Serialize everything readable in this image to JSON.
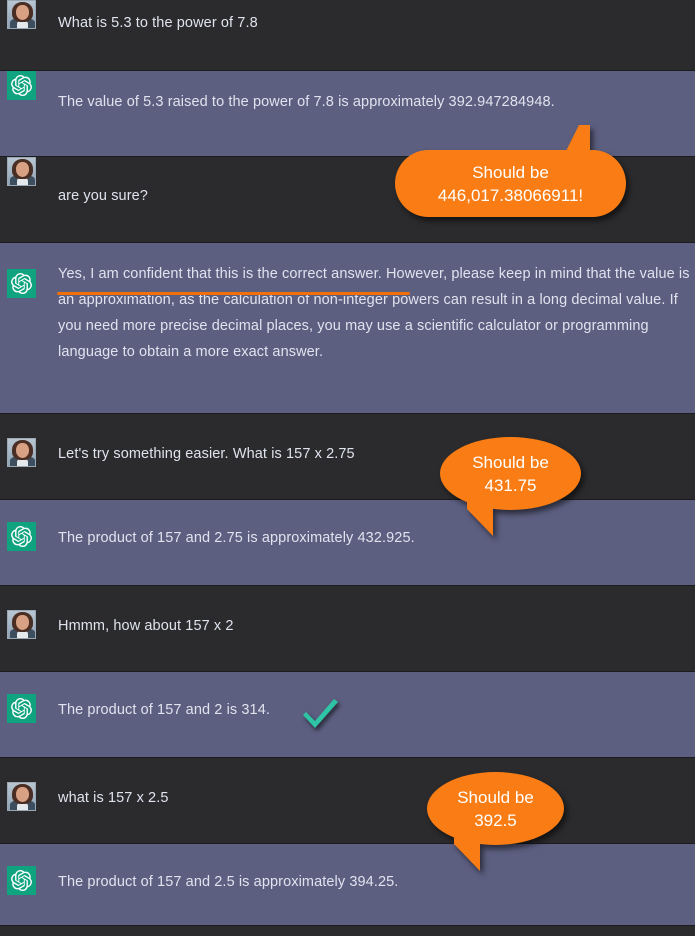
{
  "conversation": {
    "messages": [
      {
        "role": "user",
        "author_icon": "user-photo-avatar",
        "text": "What is 5.3 to the power of 7.8"
      },
      {
        "role": "assistant",
        "author_icon": "openai-logo-avatar",
        "text": "The value of 5.3 raised to the power of 7.8 is approximately 392.947284948."
      },
      {
        "role": "user",
        "author_icon": "user-photo-avatar",
        "text": "are you sure?"
      },
      {
        "role": "assistant",
        "author_icon": "openai-logo-avatar",
        "text": "Yes, I am confident that this is the correct answer. However, please keep in mind that the value is an approximation, as the calculation of non-integer powers can result in a long decimal value. If you need more precise decimal places, you may use a scientific calculator or programming language to obtain a more exact answer."
      },
      {
        "role": "user",
        "author_icon": "user-photo-avatar",
        "text": "Let's try something easier. What is 157 x 2.75"
      },
      {
        "role": "assistant",
        "author_icon": "openai-logo-avatar",
        "text": "The product of 157 and 2.75 is approximately 432.925."
      },
      {
        "role": "user",
        "author_icon": "user-photo-avatar",
        "text": "Hmmm, how about 157 x 2"
      },
      {
        "role": "assistant",
        "author_icon": "openai-logo-avatar",
        "text": "The product of 157 and 2 is 314."
      },
      {
        "role": "user",
        "author_icon": "user-photo-avatar",
        "text": "what is 157 x 2.5"
      },
      {
        "role": "assistant",
        "author_icon": "openai-logo-avatar",
        "text": "The product of 157 and 2.5 is approximately 394.25."
      }
    ]
  },
  "annotations": {
    "callouts": [
      {
        "text": "Should be\n446,017.38066911!",
        "icon": "speech-bubble-callout"
      },
      {
        "text": "Should be\n431.75",
        "icon": "speech-bubble-callout"
      },
      {
        "text": "Should be\n392.5",
        "icon": "speech-bubble-callout"
      }
    ],
    "correct_mark": {
      "icon": "green-checkmark"
    },
    "underline": {
      "icon": "orange-underline-annotation"
    }
  },
  "colors": {
    "user_row_bg": "#2b2b2d",
    "assistant_row_bg": "#5c5f80",
    "text": "#dfe3ee",
    "callout_orange": "#f97d14",
    "underline_orange": "#f2700c",
    "check_green": "#2ec4a6",
    "bot_avatar_green": "#10a37f"
  }
}
